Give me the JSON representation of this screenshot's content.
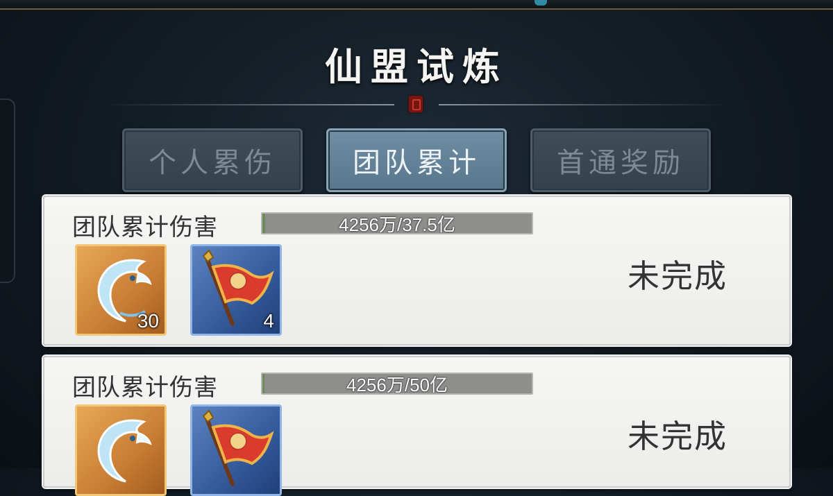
{
  "header": {
    "title": "仙盟试炼"
  },
  "tabs": [
    {
      "label": "个人累伤",
      "active": false
    },
    {
      "label": "团队累计",
      "active": true
    },
    {
      "label": "首通奖励",
      "active": false
    }
  ],
  "rewards": [
    {
      "label": "团队累计伤害",
      "progress_text": "4256万/37.5亿",
      "progress_fraction": 0.0114,
      "items": [
        {
          "icon": "moon-blade-icon",
          "count": "30"
        },
        {
          "icon": "red-banner-flag-icon",
          "count": "4"
        }
      ],
      "status": "未完成"
    },
    {
      "label": "团队累计伤害",
      "progress_text": "4256万/50亿",
      "progress_fraction": 0.0085,
      "items": [
        {
          "icon": "moon-blade-icon",
          "count": ""
        },
        {
          "icon": "red-banner-flag-icon",
          "count": ""
        }
      ],
      "status": "未完成"
    }
  ],
  "colors": {
    "active_tab": "#6f8da3",
    "inactive_tab": "#3f4d58",
    "card_bg": "#f1f1ef",
    "gold_item": "#c87d34",
    "blue_item": "#345a9a"
  }
}
